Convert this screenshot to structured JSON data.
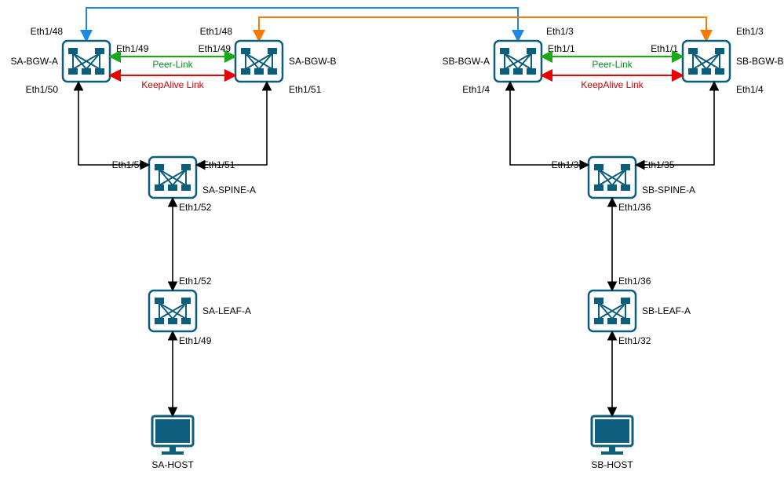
{
  "diagram_type": "network-topology",
  "sites": {
    "A": {
      "bgw_a": {
        "name": "SA-BGW-A",
        "if_top": "Eth1/48",
        "if_right": "Eth1/49",
        "if_down": "Eth1/50"
      },
      "bgw_b": {
        "name": "SA-BGW-B",
        "if_top": "Eth1/48",
        "if_left": "Eth1/49",
        "if_down": "Eth1/51"
      },
      "peer_link": "Peer-Link",
      "keepalive": "KeepAlive Link",
      "spine": {
        "name": "SA-SPINE-A",
        "if_left": "Eth1/50",
        "if_right": "Eth1/51",
        "if_down": "Eth1/52"
      },
      "leaf": {
        "name": "SA-LEAF-A",
        "if_top": "Eth1/52",
        "if_down": "Eth1/49"
      },
      "host": {
        "name": "SA-HOST"
      }
    },
    "B": {
      "bgw_a": {
        "name": "SB-BGW-A",
        "if_top": "Eth1/3",
        "if_right": "Eth1/1",
        "if_down": "Eth1/4"
      },
      "bgw_b": {
        "name": "SB-BGW-B",
        "if_top": "Eth1/3",
        "if_left": "Eth1/1",
        "if_down": "Eth1/4"
      },
      "peer_link": "Peer-Link",
      "keepalive": "KeepAlive Link",
      "spine": {
        "name": "SB-SPINE-A",
        "if_left": "Eth1/34",
        "if_right": "Eth1/35",
        "if_down": "Eth1/36"
      },
      "leaf": {
        "name": "SB-LEAF-A",
        "if_top": "Eth1/36",
        "if_down": "Eth1/32"
      },
      "host": {
        "name": "SB-HOST"
      }
    }
  },
  "colors": {
    "dci_blue": "#1e88e5",
    "dci_orange": "#f57c00",
    "peer_green": "#1ba91b",
    "keepalive_red": "#e60000",
    "black": "#000000",
    "device_stroke": "#0d5e7d",
    "device_fill": "#ffffff",
    "icon_fill": "#0d5e7d"
  }
}
